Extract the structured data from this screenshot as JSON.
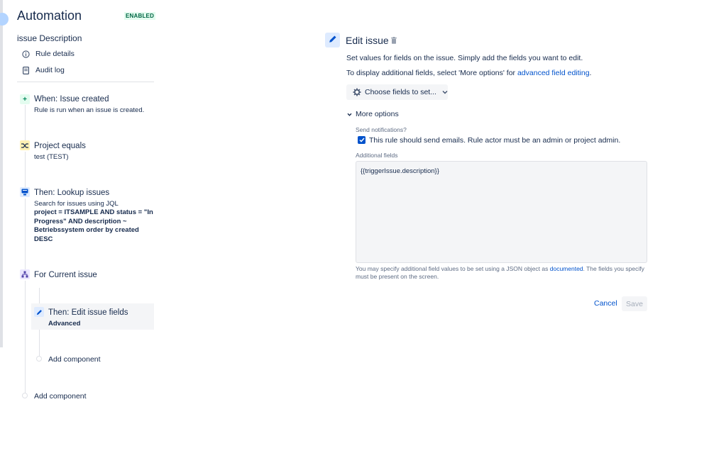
{
  "header": {
    "title": "Automation",
    "status_badge": "ENABLED",
    "rule_name": "issue Description"
  },
  "nav": {
    "rule_details": "Rule details",
    "audit_log": "Audit log"
  },
  "steps": {
    "trigger": {
      "title": "When: Issue created",
      "subtitle": "Rule is run when an issue is created."
    },
    "condition": {
      "title": "Project equals",
      "subtitle": "test (TEST)"
    },
    "lookup": {
      "title": "Then: Lookup issues",
      "subtitle": "Search for issues using JQL",
      "jql": "project = ITSAMPLE AND status = \"In Progress\" AND description ~ Betriebssystem order by created DESC"
    },
    "branch": {
      "title": "For Current issue"
    },
    "edit": {
      "title": "Then: Edit issue fields",
      "subtitle": "Advanced"
    },
    "add_nested": "Add component",
    "add_root": "Add component"
  },
  "panel": {
    "title": "Edit issue",
    "description": "Set values for fields on the issue. Simply add the fields you want to edit.",
    "more_info_prefix": "To display additional fields, select 'More options' for ",
    "more_info_link": "advanced field editing",
    "more_info_suffix": ".",
    "choose_fields_label": "Choose fields to set...",
    "more_options_label": "More options",
    "send_notifications_label": "Send notifications?",
    "send_notifications_checked": true,
    "send_notifications_text": "This rule should send emails. Rule actor must be an admin or project admin.",
    "additional_fields_label": "Additional fields",
    "additional_fields_value": "{{triggerIssue.description}}",
    "help_prefix": "You may specify additional field values to be set using a JSON object as ",
    "help_link": "documented",
    "help_suffix": ". The fields you specify must be present on the screen.",
    "cancel_label": "Cancel",
    "save_label": "Save"
  },
  "colors": {
    "brand_blue": "#0052cc",
    "trigger_green": "#e3fcef",
    "condition_yellow": "#fff0b3",
    "action_blue": "#deebff",
    "branch_purple": "#eae6ff"
  },
  "icons": {
    "rule_details": "info-icon",
    "audit_log": "document-icon",
    "trigger": "plus-icon",
    "condition": "shuffle-icon",
    "lookup": "lookup-icon",
    "branch": "branch-icon",
    "edit": "pencil-icon",
    "delete": "trash-icon",
    "choose_fields": "gear-icon"
  }
}
